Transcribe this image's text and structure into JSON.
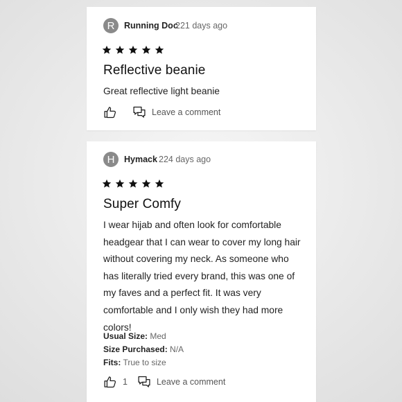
{
  "reviews": [
    {
      "avatar_letter": "R",
      "author": "Running Doc",
      "date": "221 days ago",
      "rating": 5,
      "title": "Reflective beanie",
      "body": "Great reflective light beanie",
      "like_count": "",
      "comment_label": "Leave a comment"
    },
    {
      "avatar_letter": "H",
      "author": "Hymack",
      "date": "224 days ago",
      "rating": 5,
      "title": "Super Comfy",
      "body": "I wear hijab and often look for comfortable headgear that I can wear to cover my long hair without covering my neck. As someone who has literally tried every brand, this was one of my faves and a perfect fit. It was very comfortable and I only wish they had more colors!",
      "details": {
        "usual_size_label": "Usual Size:",
        "usual_size_value": "Med",
        "size_purchased_label": "Size Purchased:",
        "size_purchased_value": "N/A",
        "fits_label": "Fits:",
        "fits_value": "True to size"
      },
      "like_count": "1",
      "comment_label": "Leave a comment"
    }
  ]
}
